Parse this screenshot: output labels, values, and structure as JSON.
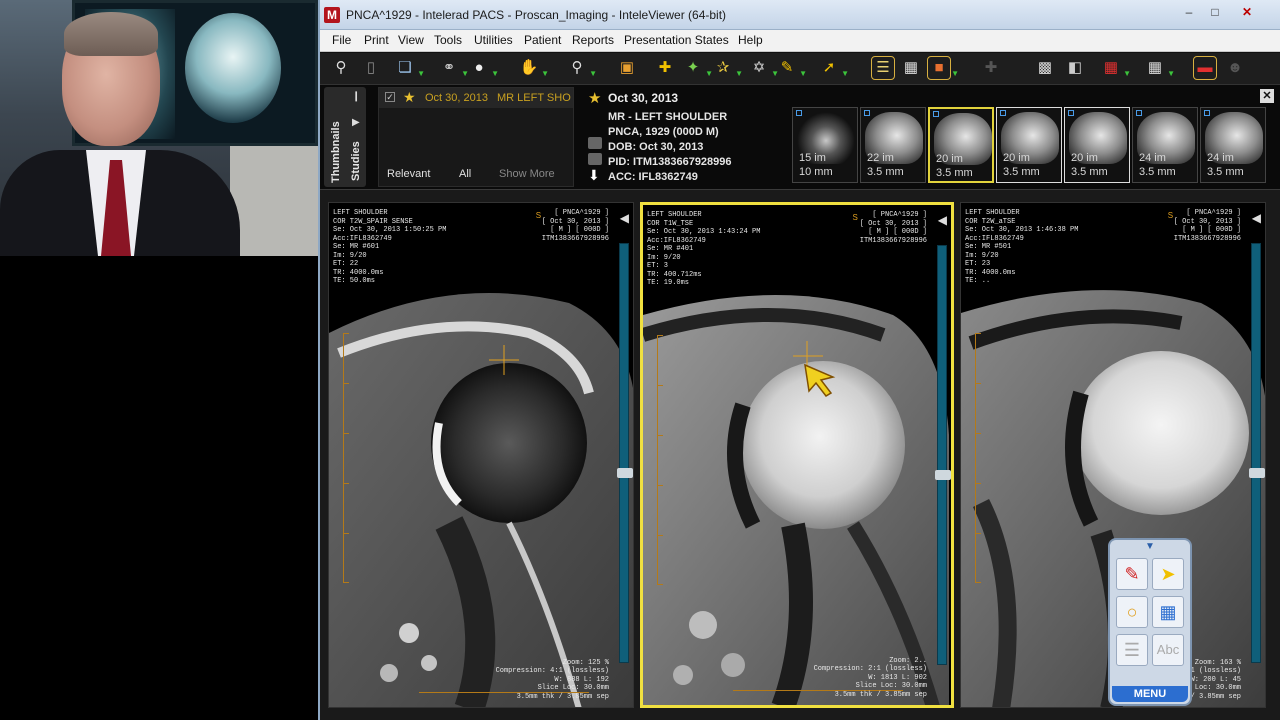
{
  "window": {
    "title": "PNCA^1929 - Intelerad PACS - Proscan_Imaging - InteleViewer (64-bit)"
  },
  "menu": [
    "File",
    "Print",
    "View",
    "Tools",
    "Utilities",
    "Patient",
    "Reports",
    "Presentation States",
    "Help"
  ],
  "study_panel": {
    "tabs": [
      "Thumbnails",
      "Studies"
    ],
    "row": {
      "date": "Oct 30, 2013",
      "desc": "MR  LEFT SHO"
    },
    "filters": [
      "Relevant",
      "All",
      "Show More"
    ]
  },
  "patient": {
    "date": "Oct 30, 2013",
    "study": "MR - LEFT SHOULDER",
    "name": "PNCA, 1929 (000D M)",
    "dob": "DOB: Oct 30, 2013",
    "pid": "PID: ITM1383667928996",
    "acc": "ACC: IFL8362749"
  },
  "thumbnails": [
    {
      "im": "15 im",
      "mm": "10 mm"
    },
    {
      "im": "22 im",
      "mm": "3.5 mm"
    },
    {
      "im": "20 im",
      "mm": "3.5 mm"
    },
    {
      "im": "20 im",
      "mm": "3.5 mm"
    },
    {
      "im": "20 im",
      "mm": "3.5 mm"
    },
    {
      "im": "24 im",
      "mm": "3.5 mm"
    },
    {
      "im": "24 im",
      "mm": "3.5 mm"
    }
  ],
  "viewports": [
    {
      "overlay_tl": "LEFT SHOULDER\nCOR T2W_SPAIR SENSE\nSe: Oct 30, 2013 1:50:25 PM\nAcc:IFL8362749\nSe: MR #601\nIm: 9/20\nET: 22\nTR: 4000.0ms\nTE: 50.0ms",
      "overlay_tr": "[ PNCA^1929 ]\n[ Oct 30, 2013 ]\n[ M ] [ 000D ]\nITM1383667928996",
      "overlay_br": "Zoom: 125 %\nCompression: 4:1 (lossless)\nW: 888 L: 192\nSlice Loc: 30.0mm\n3.5mm thk / 3.85mm sep",
      "scroll_pos": 0.55
    },
    {
      "overlay_tl": "LEFT SHOULDER\nCOR T1W_TSE\nSe: Oct 30, 2013 1:43:24 PM\nAcc:IFL8362749\nSe: MR #401\nIm: 9/20\nET: 3\nTR: 400.712ms\nTE: 19.0ms",
      "overlay_tr": "[ PNCA^1929 ]\n[ Oct 30, 2013 ]\n[ M ] [ 000D ]\nITM1383667928996",
      "overlay_br": "Zoom: 2..\nCompression: 2:1 (lossless)\nW: 1813 L: 902\nSlice Loc: 30.0mm\n3.5mm thk / 3.85mm sep",
      "scroll_pos": 0.55
    },
    {
      "overlay_tl": "LEFT SHOULDER\nCOR T2W_aTSE\nSe: Oct 30, 2013 1:46:38 PM\nAcc:IFL8362749\nSe: MR #501\nIm: 9/20\nET: 23\nTR: 4000.0ms\nTE: ..",
      "overlay_tr": "[ PNCA^1929 ]\n[ Oct 30, 2013 ]\n[ M ] [ 000D ]\nITM1383667928996",
      "overlay_br": "Zoom: 163 %\nCompression: 3:1 (lossless)\nW: 200 L: 45\nSlice Loc: 30.0mm\n3.5mm thk / 3.85mm sep",
      "scroll_pos": 0.55
    }
  ],
  "floating_menu": {
    "label": "MENU"
  },
  "colors": {
    "active_border": "#f0e040",
    "accent_star": "#e8c030"
  }
}
